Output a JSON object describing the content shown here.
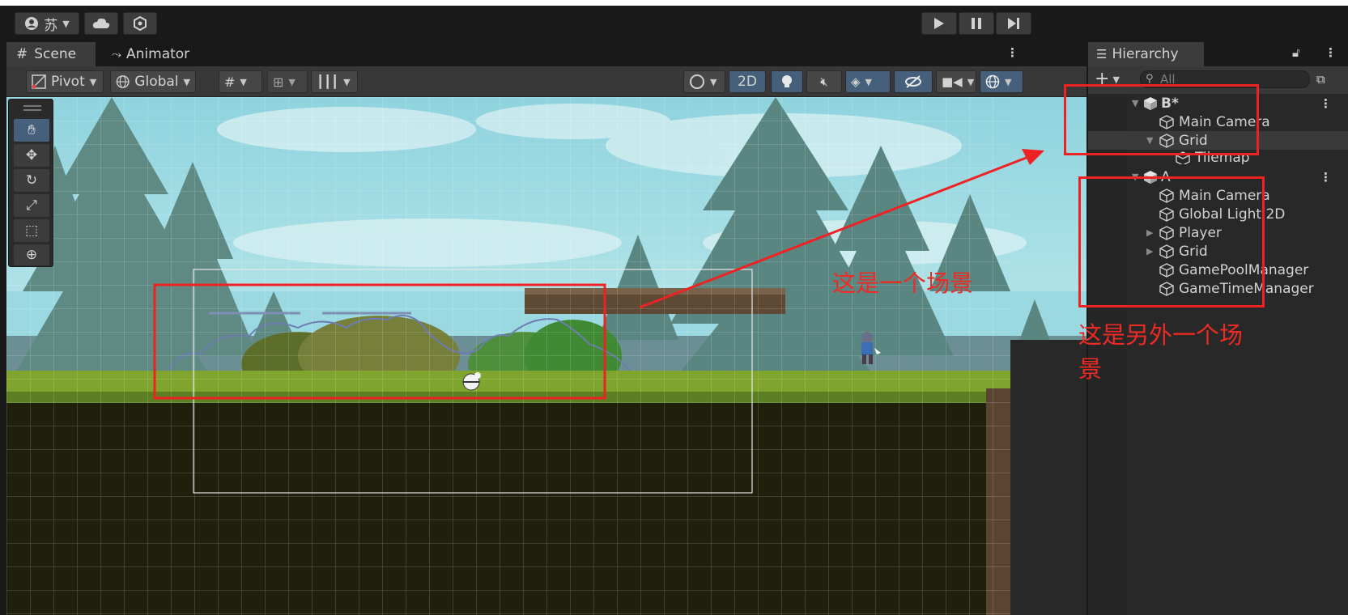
{
  "top_toolbar": {
    "account_label": "苏",
    "play_icon": "play-icon",
    "pause_icon": "pause-icon",
    "step_icon": "step-icon"
  },
  "scene_panel": {
    "tabs": [
      {
        "label": "Scene",
        "icon": "hash-grid-icon"
      },
      {
        "label": "Animator",
        "icon": "animator-icon"
      }
    ],
    "toolbar": {
      "pivot_label": "Pivot",
      "global_label": "Global",
      "mode_2d_label": "2D"
    },
    "tools": [
      "hand-tool-icon",
      "move-tool-icon",
      "rotate-tool-icon",
      "scale-tool-icon",
      "rect-tool-icon",
      "transform-tool-icon"
    ]
  },
  "hierarchy": {
    "tab_label": "Hierarchy",
    "search_placeholder": "All",
    "scenes": [
      {
        "name": "B*",
        "items": [
          {
            "label": "Main Camera",
            "depth": 1,
            "expandable": false
          },
          {
            "label": "Grid",
            "depth": 1,
            "expandable": true,
            "expanded": true
          },
          {
            "label": "Tilemap",
            "depth": 2,
            "expandable": false
          }
        ]
      },
      {
        "name": "A",
        "items": [
          {
            "label": "Main Camera",
            "depth": 1,
            "expandable": false
          },
          {
            "label": "Global Light 2D",
            "depth": 1,
            "expandable": false
          },
          {
            "label": "Player",
            "depth": 1,
            "expandable": true,
            "expanded": false
          },
          {
            "label": "Grid",
            "depth": 1,
            "expandable": true,
            "expanded": false
          },
          {
            "label": "GamePoolManager",
            "depth": 1,
            "expandable": false
          },
          {
            "label": "GameTimeManager",
            "depth": 1,
            "expandable": false
          }
        ]
      }
    ]
  },
  "annotations": {
    "scene_note": "这是一个场景",
    "other_scene_note_line1": "这是另外一个场",
    "other_scene_note_line2": "景",
    "color": "#ee2a24"
  },
  "colors": {
    "accent_blue": "#46607c",
    "panel": "#282828",
    "sky": "#a8dde3",
    "grass": "#7fa52e"
  }
}
